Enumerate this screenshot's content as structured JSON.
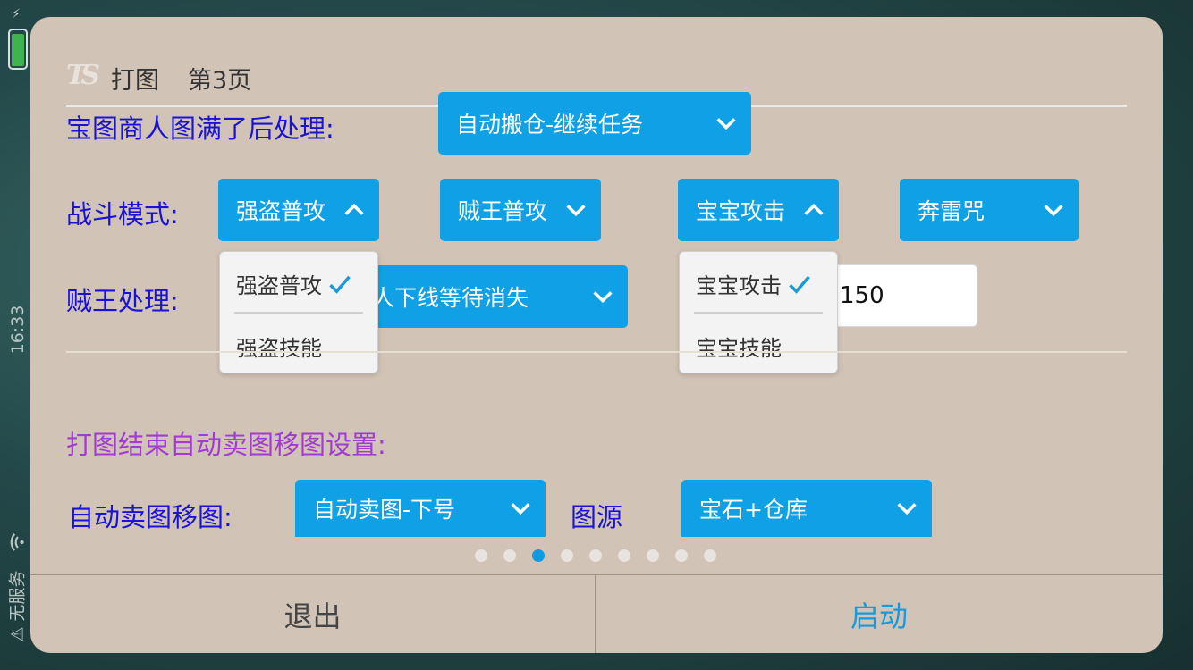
{
  "status_bar": {
    "time": "16:33",
    "carrier": "无服务"
  },
  "dialog": {
    "logo": "TS",
    "title": "打图",
    "page": "第3页",
    "rows": {
      "merchant": {
        "label": "宝图商人图满了后处理:",
        "dropdown": "自动搬仓-继续任务"
      },
      "battle": {
        "label": "战斗模式:",
        "dropdowns": [
          "强盗普攻",
          "贼王普攻",
          "宝宝攻击",
          "奔雷咒"
        ]
      },
      "thief": {
        "label": "贼王处理:",
        "dropdown_partial": "人下线等待消失",
        "input_value": "150"
      }
    },
    "menus": {
      "menu1": {
        "items": [
          "强盗普攻",
          "强盗技能"
        ],
        "selected": "强盗普攻"
      },
      "menu2": {
        "items": [
          "宝宝攻击",
          "宝宝技能"
        ],
        "selected": "宝宝攻击"
      }
    },
    "section_title": "打图结束自动卖图移图设置:",
    "sell": {
      "label": "自动卖图移图:",
      "dropdown": "自动卖图-下号",
      "source_label": "图源",
      "source_dropdown": "宝石+仓库"
    },
    "pager": {
      "count": 9,
      "active_index": 2
    },
    "footer": {
      "exit": "退出",
      "start": "启动"
    }
  },
  "colors": {
    "accent": "#10a0e6",
    "label": "#1a12d6",
    "section": "#a23ad3",
    "dialog_bg": "#d1c3b5"
  }
}
